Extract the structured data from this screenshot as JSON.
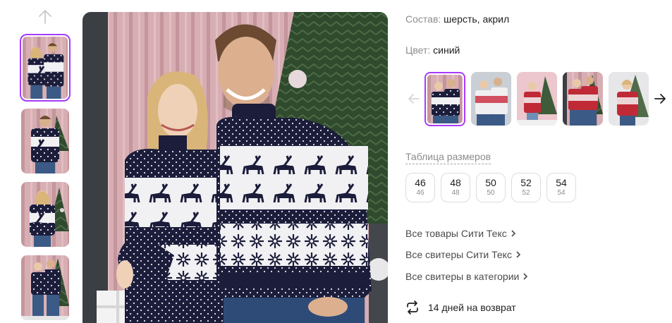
{
  "gallery": {
    "thumbs": [
      {
        "name": "couple-navy-sweaters",
        "active": true
      },
      {
        "name": "man-navy-sweater",
        "active": false
      },
      {
        "name": "woman-navy-sweater",
        "active": false
      },
      {
        "name": "couple-standing",
        "active": false
      }
    ],
    "main_image": "couple-navy-sweaters"
  },
  "product": {
    "composition_label": "Состав:",
    "composition_value": "шерсть, акрил",
    "color_label": "Цвет:",
    "color_value": "синий"
  },
  "colors": {
    "thumbs": [
      {
        "name": "navy",
        "active": true
      },
      {
        "name": "white-red",
        "active": false
      },
      {
        "name": "pink-bg-red",
        "active": false
      },
      {
        "name": "red-couple",
        "active": false
      },
      {
        "name": "red-woman",
        "active": false
      }
    ]
  },
  "sizes": {
    "table_link": "Таблица размеров",
    "options": [
      {
        "label": "46",
        "sub": "46"
      },
      {
        "label": "48",
        "sub": "48"
      },
      {
        "label": "50",
        "sub": "50"
      },
      {
        "label": "52",
        "sub": "52"
      },
      {
        "label": "54",
        "sub": "54"
      }
    ]
  },
  "links": {
    "all_brand": "Все товары Сити Текс",
    "all_brand_sweaters": "Все свитеры Сити Текс",
    "all_category_sweaters": "Все свитеры в категории"
  },
  "returns": {
    "text": "14 дней на возврат"
  },
  "colors_palette": {
    "accent": "#a73afd",
    "navy": "#1b1d3a",
    "curtain": "#d5a9ae"
  }
}
